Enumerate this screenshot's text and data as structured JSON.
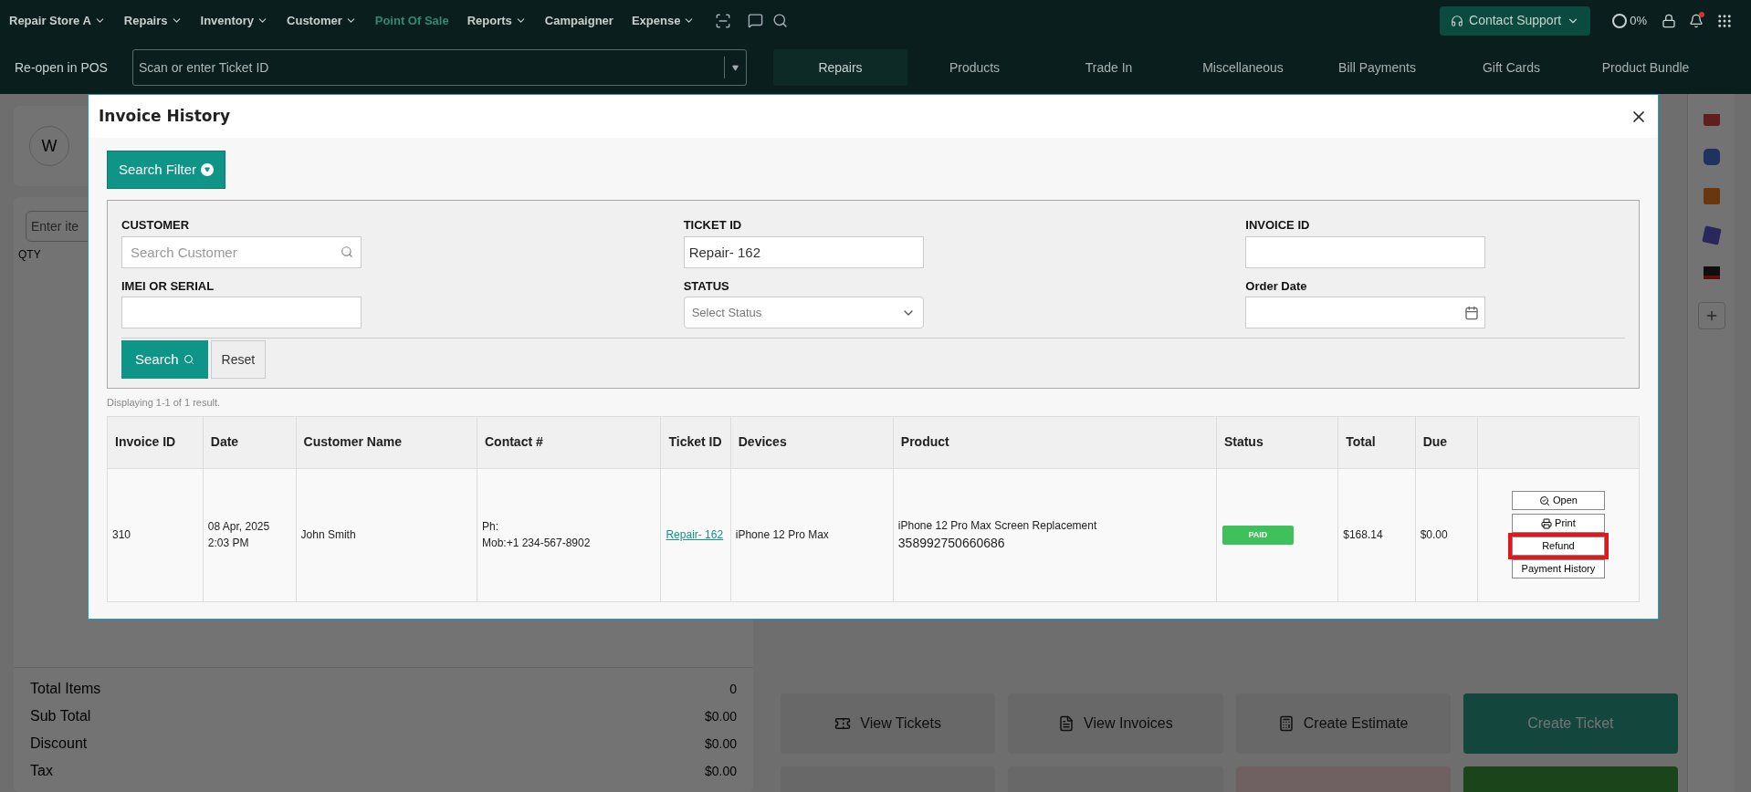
{
  "nav": {
    "items": [
      {
        "label": "Repair Store A",
        "dropdown": true,
        "selected": false
      },
      {
        "label": "Repairs",
        "dropdown": true,
        "selected": false
      },
      {
        "label": "Inventory",
        "dropdown": true,
        "selected": false
      },
      {
        "label": "Customer",
        "dropdown": true,
        "selected": false
      },
      {
        "label": "Point Of Sale",
        "dropdown": false,
        "selected": true
      },
      {
        "label": "Reports",
        "dropdown": true,
        "selected": false
      },
      {
        "label": "Campaigner",
        "dropdown": false,
        "selected": false
      },
      {
        "label": "Expense",
        "dropdown": true,
        "selected": false
      }
    ],
    "support_button": "Contact Support",
    "progress": "0%",
    "notification_dot": true
  },
  "pos_bar": {
    "reopen_label": "Re-open in POS",
    "ticket_field": {
      "placeholder": "Scan or enter Ticket ID"
    },
    "tabs": [
      {
        "label": "Repairs",
        "selected": true
      },
      {
        "label": "Products",
        "selected": false
      },
      {
        "label": "Trade In",
        "selected": false
      },
      {
        "label": "Miscellaneous",
        "selected": false
      },
      {
        "label": "Bill Payments",
        "selected": false
      },
      {
        "label": "Gift Cards",
        "selected": false
      },
      {
        "label": "Product Bundle",
        "selected": false
      }
    ]
  },
  "background": {
    "avatar": "W",
    "item_field": {
      "placeholder": "Enter ite"
    },
    "qty_header": "QTY",
    "totals": [
      {
        "label": "Total Items",
        "value": "0"
      },
      {
        "label": "Sub Total",
        "value": "$0.00"
      },
      {
        "label": "Discount",
        "value": "$0.00"
      },
      {
        "label": "Tax",
        "value": "$0.00"
      }
    ],
    "actions": [
      {
        "label": "View Tickets",
        "kind": "ticket"
      },
      {
        "label": "View Invoices",
        "kind": "invoice"
      },
      {
        "label": "Create Estimate",
        "kind": "estimate"
      },
      {
        "label": "Create Ticket",
        "kind": "primary"
      }
    ]
  },
  "dialog": {
    "title": "Invoice History",
    "filter_button": "Search Filter",
    "filters": [
      {
        "label": "CUSTOMER",
        "kind": "search",
        "placeholder": "Search Customer"
      },
      {
        "label": "TICKET ID",
        "kind": "text",
        "value": "Repair- 162"
      },
      {
        "label": "INVOICE ID",
        "kind": "text"
      },
      {
        "label": "IMEI OR SERIAL",
        "kind": "text"
      },
      {
        "label": "STATUS",
        "kind": "select",
        "placeholder": "Select Status"
      },
      {
        "label": "Order Date",
        "kind": "date"
      }
    ],
    "search_button": "Search",
    "reset_button": "Reset",
    "result_text": "Displaying 1-1 of 1 result.",
    "table": {
      "columns": [
        "Invoice ID",
        "Date",
        "Customer Name",
        "Contact #",
        "Ticket ID",
        "Devices",
        "Product",
        "Status",
        "Total",
        "Due"
      ],
      "rows": [
        {
          "invoice_id": "310",
          "date": [
            "08 Apr, 2025",
            "2:03 PM"
          ],
          "customer": "John Smith",
          "contact": [
            "Ph:",
            "Mob:+1 234-567-8902"
          ],
          "ticket_id": "Repair- 162",
          "device": "iPhone 12 Pro Max",
          "product": "iPhone 12 Pro Max Screen Replacement",
          "serial": "358992750660686",
          "status": "PAID",
          "total": "$168.14",
          "due": "$0.00",
          "actions": [
            {
              "label": "Open",
              "kind": "open",
              "highlighted": false
            },
            {
              "label": "Print",
              "kind": "print",
              "highlighted": false
            },
            {
              "label": "Refund",
              "kind": "plain",
              "highlighted": true
            },
            {
              "label": "Payment History",
              "kind": "plain",
              "highlighted": false
            }
          ]
        }
      ]
    }
  }
}
